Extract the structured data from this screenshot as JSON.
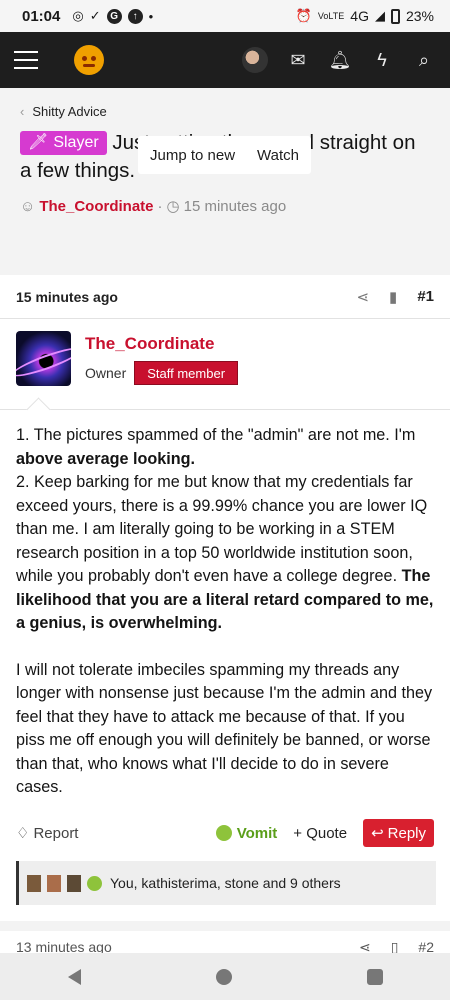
{
  "status_bar": {
    "time": "01:04",
    "network": "4G",
    "battery": "23%",
    "volte": "VoLTE"
  },
  "header": {
    "icons": [
      "menu-icon",
      "logo-angry-face",
      "user-avatar",
      "mail-icon",
      "bell-icon",
      "bolt-icon",
      "search-icon"
    ]
  },
  "thread": {
    "breadcrumb": "Shitty Advice",
    "prefix": "Slayer",
    "title": "Just setting the record straight on a few things.",
    "author": "The_Coordinate",
    "time": "15 minutes ago",
    "jump_label": "Jump to new",
    "watch_label": "Watch"
  },
  "post": {
    "time": "15 minutes ago",
    "number": "#1",
    "username": "The_Coordinate",
    "role": "Owner",
    "badge": "Staff member",
    "p1a": "1. The pictures spammed of the \"admin\" are not me. I'm ",
    "p1b": "above average looking.",
    "p2a": "2. Keep barking for me but know that my credentials far exceed yours, there is a 99.99% chance you are lower IQ than me. I am literally going to be working in a STEM research position in a top 50 worldwide institution soon, while you probably don't even have a college degree. ",
    "p2b": "The likelihood that you are a literal retard compared to me, a genius, is overwhelming.",
    "p3": "I will not tolerate imbeciles spamming my threads any longer with nonsense just because I'm the admin and they feel that they have to attack me because of that. If you piss me off enough you will definitely be banned, or worse than that, who knows what I'll decide to do in severe cases.",
    "report": "Report",
    "vomit": "Vomit",
    "quote": "+ Quote",
    "reply": "Reply",
    "reactions": "You, kathisterima, stone and 9 others"
  },
  "next_post": {
    "time": "13 minutes ago",
    "number": "#2"
  }
}
